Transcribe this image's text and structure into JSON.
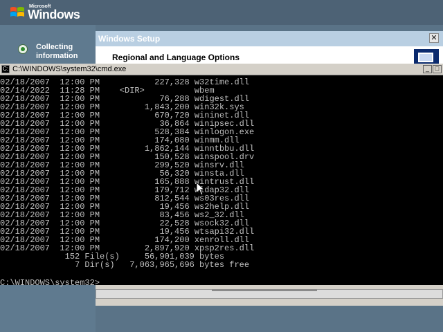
{
  "desktop": {
    "logo_small": "Microsoft",
    "logo_big": "Windows"
  },
  "setup_steps": [
    {
      "label": "Collecting information",
      "state": "current"
    }
  ],
  "setup_window": {
    "title": "Windows Setup",
    "close_symbol": "✕",
    "heading": "Regional and Language Options"
  },
  "cmd": {
    "title": "C:\\WINDOWS\\system32\\cmd.exe",
    "min_symbol": "_",
    "max_symbol": "□",
    "listing": [
      "02/18/2007  12:00 PM           227,328 w32time.dll",
      "02/14/2022  11:28 PM    <DIR>          wbem",
      "02/18/2007  12:00 PM            76,288 wdigest.dll",
      "02/18/2007  12:00 PM         1,843,200 win32k.sys",
      "02/18/2007  12:00 PM           670,720 wininet.dll",
      "02/18/2007  12:00 PM            36,864 winipsec.dll",
      "02/18/2007  12:00 PM           528,384 winlogon.exe",
      "02/18/2007  12:00 PM           174,080 winmm.dll",
      "02/18/2007  12:00 PM         1,862,144 winntbbu.dll",
      "02/18/2007  12:00 PM           150,528 winspool.drv",
      "02/18/2007  12:00 PM           299,520 winsrv.dll",
      "02/18/2007  12:00 PM            56,320 winsta.dll",
      "02/18/2007  12:00 PM           165,888 wintrust.dll",
      "02/18/2007  12:00 PM           179,712 wldap32.dll",
      "02/18/2007  12:00 PM           812,544 ws03res.dll",
      "02/18/2007  12:00 PM            19,456 ws2help.dll",
      "02/18/2007  12:00 PM            83,456 ws2_32.dll",
      "02/18/2007  12:00 PM            22,528 wsock32.dll",
      "02/18/2007  12:00 PM            19,456 wtsapi32.dll",
      "02/18/2007  12:00 PM           174,200 xenroll.dll",
      "02/18/2007  12:00 PM         2,897,920 xpsp2res.dll"
    ],
    "summary_files": "             152 File(s)     56,901,039 bytes",
    "summary_dirs": "               7 Dir(s)   7,063,965,696 bytes free",
    "prompt": "C:\\WINDOWS\\system32>"
  },
  "colors": {
    "console_bg": "#000000",
    "console_text": "#c0c0c0",
    "desktop_bg": "#5a7387"
  }
}
